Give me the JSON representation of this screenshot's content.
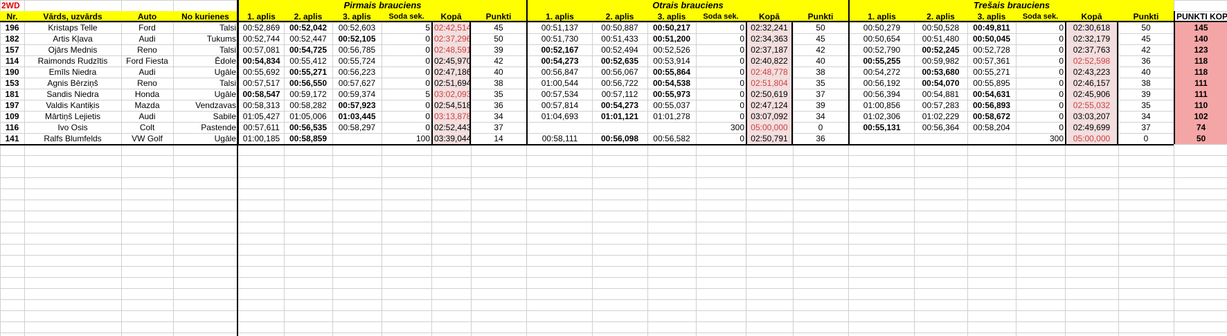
{
  "title": "2WD",
  "group_headers": [
    "Pirmais brauciens",
    "Otrais brauciens",
    "Trešais brauciens"
  ],
  "col_headers": [
    "Nr.",
    "Vārds, uzvārds",
    "Auto",
    "No kurienes",
    "1. aplis",
    "2. aplis",
    "3. aplis",
    "Soda sek.",
    "Kopā",
    "Punkti",
    "1. aplis",
    "2. aplis",
    "3. aplis",
    "Soda sek.",
    "Kopā",
    "Punkti",
    "1. aplis",
    "2. aplis",
    "3. aplis",
    "Soda sek.",
    "Kopā",
    "Punkti",
    "PUNKTI KOPĀ"
  ],
  "rows": [
    {
      "nr": "196",
      "name": "Kristaps Telle",
      "auto": "Ford",
      "from": "Talsi",
      "r1": [
        "00:52,869",
        "00:52,042",
        "00:52,603",
        "5",
        "02:42,514",
        "45"
      ],
      "r2": [
        "00:51,137",
        "00:50,887",
        "00:50,217",
        "0",
        "02:32,241",
        "50"
      ],
      "r3": [
        "00:50,279",
        "00:50,528",
        "00:49,811",
        "0",
        "02:30,618",
        "50"
      ],
      "total": "145"
    },
    {
      "nr": "182",
      "name": "Artis Kļava",
      "auto": "Audi",
      "from": "Tukums",
      "r1": [
        "00:52,744",
        "00:52,447",
        "00:52,105",
        "0",
        "02:37,296",
        "50"
      ],
      "r2": [
        "00:51,730",
        "00:51,433",
        "00:51,200",
        "0",
        "02:34,363",
        "45"
      ],
      "r3": [
        "00:50,654",
        "00:51,480",
        "00:50,045",
        "0",
        "02:32,179",
        "45"
      ],
      "total": "140"
    },
    {
      "nr": "157",
      "name": "Ojārs Mednis",
      "auto": "Reno",
      "from": "Talsi",
      "r1": [
        "00:57,081",
        "00:54,725",
        "00:56,785",
        "0",
        "02:48,591",
        "39"
      ],
      "r2": [
        "00:52,167",
        "00:52,494",
        "00:52,526",
        "0",
        "02:37,187",
        "42"
      ],
      "r3": [
        "00:52,790",
        "00:52,245",
        "00:52,728",
        "0",
        "02:37,763",
        "42"
      ],
      "total": "123"
    },
    {
      "nr": "114",
      "name": "Raimonds Rudzītis",
      "auto": "Ford Fiesta",
      "from": "Ēdole",
      "r1": [
        "00:54,834",
        "00:55,412",
        "00:55,724",
        "0",
        "02:45,970",
        "42"
      ],
      "r2": [
        "00:54,273",
        "00:52,635",
        "00:53,914",
        "0",
        "02:40,822",
        "40"
      ],
      "r3": [
        "00:55,255",
        "00:59,982",
        "00:57,361",
        "0",
        "02:52,598",
        "36"
      ],
      "total": "118"
    },
    {
      "nr": "190",
      "name": "Emīls Niedra",
      "auto": "Audi",
      "from": "Ugāle",
      "r1": [
        "00:55,692",
        "00:55,271",
        "00:56,223",
        "0",
        "02:47,186",
        "40"
      ],
      "r2": [
        "00:56,847",
        "00:56,067",
        "00:55,864",
        "0",
        "02:48,778",
        "38"
      ],
      "r3": [
        "00:54,272",
        "00:53,680",
        "00:55,271",
        "0",
        "02:43,223",
        "40"
      ],
      "total": "118"
    },
    {
      "nr": "153",
      "name": "Agnis Bērziņš",
      "auto": "Reno",
      "from": "Talsi",
      "r1": [
        "00:57,517",
        "00:56,550",
        "00:57,627",
        "0",
        "02:51,694",
        "38"
      ],
      "r2": [
        "01:00,544",
        "00:56,722",
        "00:54,538",
        "0",
        "02:51,804",
        "35"
      ],
      "r3": [
        "00:56,192",
        "00:54,070",
        "00:55,895",
        "0",
        "02:46,157",
        "38"
      ],
      "total": "111"
    },
    {
      "nr": "181",
      "name": "Sandis Niedra",
      "auto": "Honda",
      "from": "Ugāle",
      "r1": [
        "00:58,547",
        "00:59,172",
        "00:59,374",
        "5",
        "03:02,093",
        "35"
      ],
      "r2": [
        "00:57,534",
        "00:57,112",
        "00:55,973",
        "0",
        "02:50,619",
        "37"
      ],
      "r3": [
        "00:56,394",
        "00:54,881",
        "00:54,631",
        "0",
        "02:45,906",
        "39"
      ],
      "total": "111"
    },
    {
      "nr": "197",
      "name": "Valdis Kantiķis",
      "auto": "Mazda",
      "from": "Vendzavas",
      "r1": [
        "00:58,313",
        "00:58,282",
        "00:57,923",
        "0",
        "02:54,518",
        "36"
      ],
      "r2": [
        "00:57,814",
        "00:54,273",
        "00:55,037",
        "0",
        "02:47,124",
        "39"
      ],
      "r3": [
        "01:00,856",
        "00:57,283",
        "00:56,893",
        "0",
        "02:55,032",
        "35"
      ],
      "total": "110"
    },
    {
      "nr": "109",
      "name": "Mārtiņš Lejietis",
      "auto": "Audi",
      "from": "Sabile",
      "r1": [
        "01:05,427",
        "01:05,006",
        "01:03,445",
        "0",
        "03:13,878",
        "34"
      ],
      "r2": [
        "01:04,693",
        "01:01,121",
        "01:01,278",
        "0",
        "03:07,092",
        "34"
      ],
      "r3": [
        "01:02,306",
        "01:02,229",
        "00:58,672",
        "0",
        "03:03,207",
        "34"
      ],
      "total": "102"
    },
    {
      "nr": "116",
      "name": "Ivo Osis",
      "auto": "Colt",
      "from": "Pastende",
      "r1": [
        "00:57,611",
        "00:56,535",
        "00:58,297",
        "0",
        "02:52,443",
        "37"
      ],
      "r2": [
        "",
        "",
        "",
        "300",
        "05:00,000",
        "0"
      ],
      "r3": [
        "00:55,131",
        "00:56,364",
        "00:58,204",
        "0",
        "02:49,699",
        "37"
      ],
      "total": "74"
    },
    {
      "nr": "141",
      "name": "Ralfs Blumfelds",
      "auto": "VW Golf",
      "from": "Ugāle",
      "r1": [
        "01:00,185",
        "00:58,859",
        "",
        "100",
        "03:39,044",
        "14"
      ],
      "r2": [
        "00:58,111",
        "00:56,098",
        "00:56,582",
        "0",
        "02:50,791",
        "36"
      ],
      "r3": [
        "",
        "",
        "",
        "300",
        "05:00,000",
        "0"
      ],
      "total": "50"
    }
  ],
  "bold_laps": [
    [
      [
        1
      ],
      [
        2
      ],
      [
        2
      ]
    ],
    [
      [
        2
      ],
      [
        2
      ],
      [
        2
      ]
    ],
    [
      [
        1
      ],
      [
        0
      ],
      [
        1
      ]
    ],
    [
      [
        0
      ],
      [
        0,
        1
      ],
      [
        0
      ]
    ],
    [
      [
        1
      ],
      [
        2
      ],
      [
        1
      ]
    ],
    [
      [
        1
      ],
      [
        2
      ],
      [
        1
      ]
    ],
    [
      [
        0
      ],
      [
        2
      ],
      [
        2
      ]
    ],
    [
      [
        2
      ],
      [
        1
      ],
      [
        2
      ]
    ],
    [
      [
        2
      ],
      [
        1
      ],
      [
        2
      ]
    ],
    [
      [
        1
      ],
      [],
      [
        0
      ]
    ],
    [
      [
        1
      ],
      [
        1
      ],
      []
    ]
  ],
  "red_kopa": [
    [
      true,
      false,
      false
    ],
    [
      true,
      false,
      false
    ],
    [
      true,
      false,
      false
    ],
    [
      false,
      false,
      true
    ],
    [
      false,
      true,
      false
    ],
    [
      false,
      true,
      false
    ],
    [
      true,
      false,
      false
    ],
    [
      false,
      false,
      true
    ],
    [
      true,
      false,
      false
    ],
    [
      false,
      true,
      false
    ],
    [
      false,
      false,
      true
    ]
  ],
  "colors": {
    "header_yellow": "#ffff00",
    "title_red": "#e00000",
    "kopa_bg": "#f2dede",
    "total_bg": "#f4a6a6"
  }
}
